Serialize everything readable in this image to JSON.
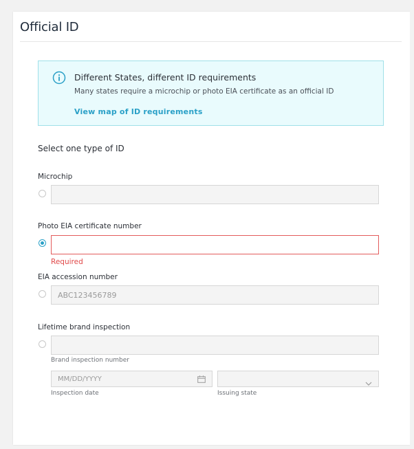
{
  "card": {
    "title": "Official ID"
  },
  "info": {
    "icon": "info-icon",
    "title": "Different States, different ID requirements",
    "subtitle": "Many states require a microchip or photo EIA certificate as an official ID",
    "link": "View map of ID requirements",
    "accent_color": "#2aa0c7",
    "background_color": "#e9fbfd",
    "border_color": "#9fe0e8"
  },
  "form": {
    "section_label": "Select one type of ID",
    "microchip": {
      "label": "Microchip",
      "value": "",
      "selected": false
    },
    "photo_eia": {
      "label": "Photo EIA certificate number",
      "value": "",
      "selected": true,
      "error": "Required",
      "error_color": "#e04848"
    },
    "eia_accession": {
      "label": "EIA accession number",
      "placeholder": "ABC123456789",
      "selected": false
    },
    "brand_inspection": {
      "label": "Lifetime brand inspection",
      "value": "",
      "selected": false,
      "number_helper": "Brand inspection number",
      "date_placeholder": "MM/DD/YYYY",
      "date_helper": "Inspection date",
      "state_helper": "Issuing state",
      "state_value": "",
      "calendar_icon": "calendar-icon",
      "dropdown_icon": "chevron-down-icon"
    }
  }
}
